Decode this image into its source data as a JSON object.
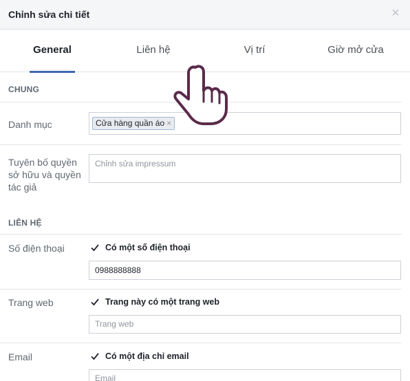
{
  "dialog": {
    "title": "Chỉnh sửa chi tiết",
    "close_symbol": "×"
  },
  "tabs": [
    {
      "label": "General",
      "active": true
    },
    {
      "label": "Liên hệ",
      "active": false
    },
    {
      "label": "Vị trí",
      "active": false
    },
    {
      "label": "Giờ mở cửa",
      "active": false
    }
  ],
  "general_section": {
    "heading": "CHUNG",
    "category_label": "Danh mục",
    "category_token": "Cửa hàng quần áo",
    "token_remove_symbol": "×",
    "impressum_label": "Tuyên bố quyền sở hữu và quyền tác giả",
    "impressum_placeholder": "Chỉnh sửa impressum"
  },
  "contact_section": {
    "heading": "LIÊN HỆ",
    "phone_label": "Số điện thoại",
    "phone_checkbox": "Có một số điện thoại",
    "phone_value": "0988888888",
    "website_label": "Trang web",
    "website_checkbox": "Trang này có một trang web",
    "website_placeholder": "Trang web",
    "email_label": "Email",
    "email_checkbox": "Có một địa chỉ email",
    "email_placeholder": "Email"
  },
  "colors": {
    "accent": "#4267b2",
    "header_bg": "#f5f6f7",
    "border": "#ccd0d5"
  },
  "icons": [
    "close-icon",
    "token-remove-icon",
    "checkmark-icon",
    "hand-pointer-icon"
  ]
}
